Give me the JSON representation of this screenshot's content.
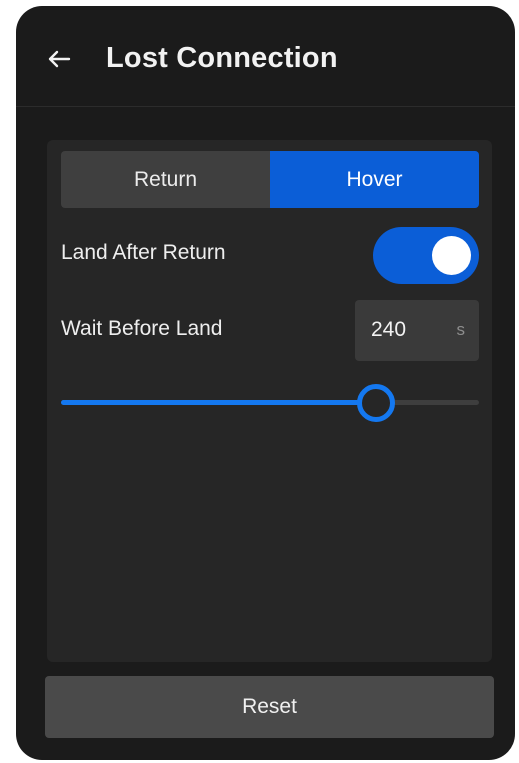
{
  "header": {
    "title": "Lost Connection",
    "back_icon": "arrow-left-icon"
  },
  "mode": {
    "options": [
      "Return",
      "Hover"
    ],
    "selected": "Hover"
  },
  "land_after_return": {
    "label": "Land After Return",
    "enabled": true
  },
  "wait_before_land": {
    "label": "Wait Before Land",
    "value": "240",
    "unit": "s",
    "slider_fraction": 0.75
  },
  "reset": {
    "label": "Reset"
  },
  "colors": {
    "accent": "#0b5ed7",
    "slider_accent": "#1478f0",
    "panel_bg": "#1b1b1b",
    "card_bg": "#262626"
  }
}
